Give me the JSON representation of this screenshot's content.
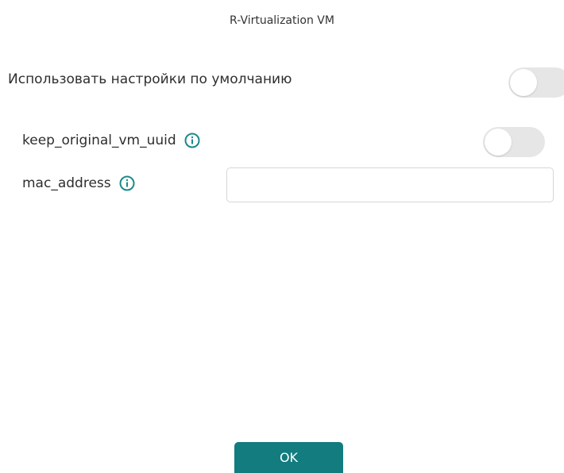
{
  "dialog": {
    "title": "R-Virtualization VM"
  },
  "use_defaults": {
    "label": "Использовать настройки по умолчанию",
    "enabled": false
  },
  "fields": {
    "keep_original_vm_uuid": {
      "label": "keep_original_vm_uuid",
      "enabled": false,
      "icon": "info-icon"
    },
    "mac_address": {
      "label": "mac_address",
      "value": "",
      "placeholder": "",
      "icon": "info-icon"
    }
  },
  "buttons": {
    "ok_label": "OK"
  },
  "colors": {
    "accent": "#127c7f",
    "toggle_off": "#e6e6e6",
    "info_icon": "#1a8a8a"
  }
}
